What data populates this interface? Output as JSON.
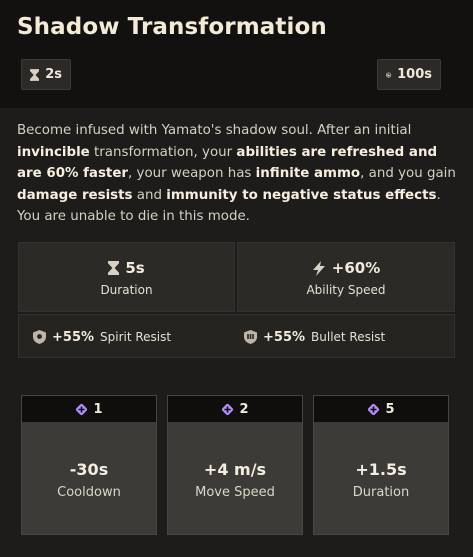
{
  "ability": {
    "title": "Shadow Transformation",
    "cast_time": "2s",
    "cooldown": "100s"
  },
  "description": [
    {
      "text": "Become infused with Yamato's shadow soul. After an initial ",
      "bold": false
    },
    {
      "text": "invincible",
      "bold": true
    },
    {
      "text": " transformation, your ",
      "bold": false
    },
    {
      "text": "abilities are refreshed and are 60% faster",
      "bold": true
    },
    {
      "text": ", your weapon has ",
      "bold": false
    },
    {
      "text": "infinite ammo",
      "bold": true
    },
    {
      "text": ", and you gain ",
      "bold": false
    },
    {
      "text": "damage resists",
      "bold": true
    },
    {
      "text": " and ",
      "bold": false
    },
    {
      "text": "immunity to negative status effects",
      "bold": true
    },
    {
      "text": ". You are unable to die in this mode.",
      "bold": false
    }
  ],
  "stats": {
    "duration": {
      "value": "5s",
      "label": "Duration",
      "icon": "hourglass-icon"
    },
    "ability_speed": {
      "value": "+60%",
      "label": "Ability Speed",
      "icon": "lightning-icon"
    },
    "spirit_resist": {
      "value": "+55%",
      "label": "Spirit Resist",
      "icon": "spirit-shield-icon"
    },
    "bullet_resist": {
      "value": "+55%",
      "label": "Bullet Resist",
      "icon": "bullet-shield-icon"
    }
  },
  "upgrades": [
    {
      "tier": "1",
      "value": "-30s",
      "label": "Cooldown"
    },
    {
      "tier": "2",
      "value": "+4 m/s",
      "label": "Move Speed"
    },
    {
      "tier": "5",
      "value": "+1.5s",
      "label": "Duration"
    }
  ],
  "colors": {
    "background": "#1e1c1a",
    "header": "#12110f",
    "tier_accent": "#b48cff",
    "text_primary": "#f2ebdc"
  }
}
